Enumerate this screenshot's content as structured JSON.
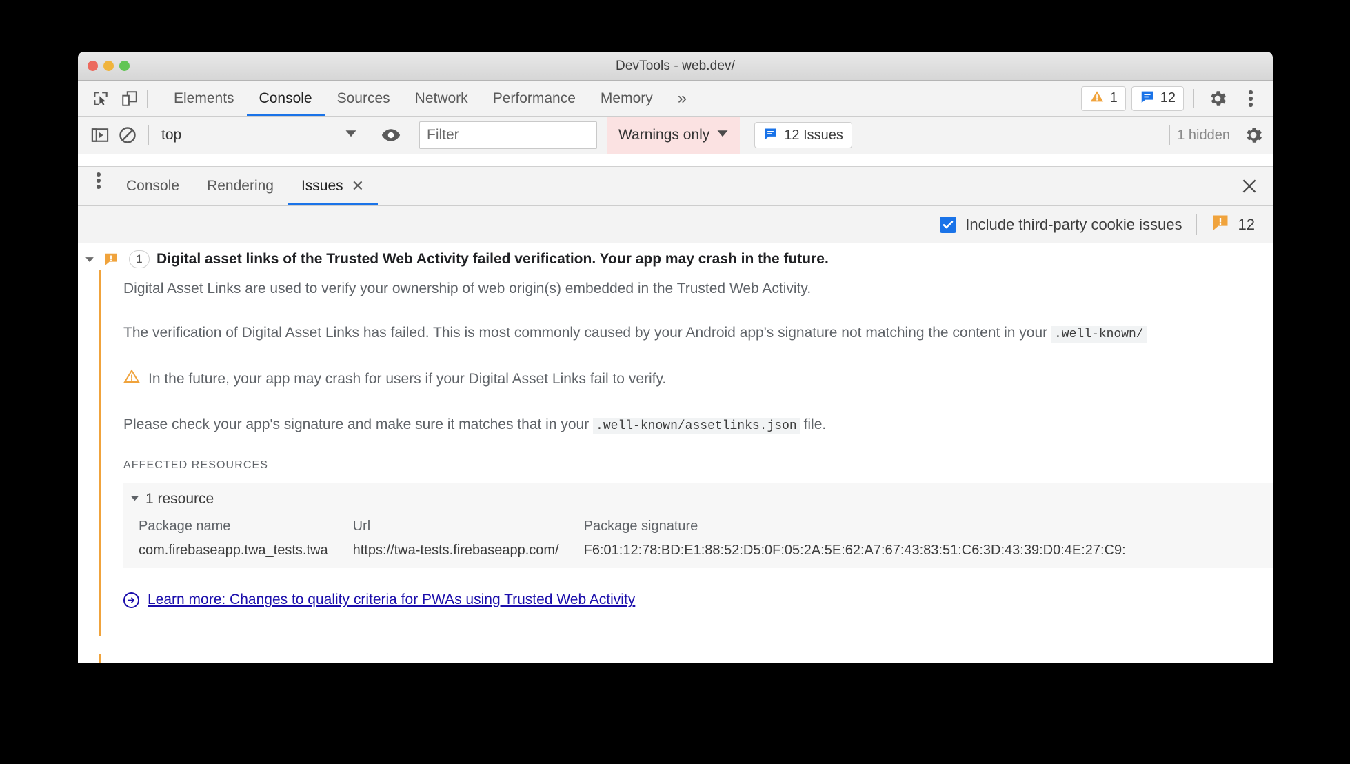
{
  "window": {
    "title": "DevTools - web.dev/",
    "traffic_lights": [
      "close",
      "minimize",
      "zoom"
    ]
  },
  "main_tabbar": {
    "left_icons": [
      {
        "name": "inspect-element-icon",
        "label": "Inspect element"
      },
      {
        "name": "device-toolbar-icon",
        "label": "Toggle device toolbar"
      }
    ],
    "tabs": [
      {
        "label": "Elements",
        "active": false
      },
      {
        "label": "Console",
        "active": true
      },
      {
        "label": "Sources",
        "active": false
      },
      {
        "label": "Network",
        "active": false
      },
      {
        "label": "Performance",
        "active": false
      },
      {
        "label": "Memory",
        "active": false
      }
    ],
    "more_tabs_label": "»",
    "warning_badge": {
      "icon": "warning-triangle-icon",
      "count": "1"
    },
    "issues_badge": {
      "icon": "issue-message-icon",
      "count": "12"
    },
    "settings_label": "Settings",
    "menu_label": "Customize and control DevTools"
  },
  "console_toolbar": {
    "sidebar_toggle": "console-sidebar-icon",
    "clear_console": "clear-console-icon",
    "context": {
      "value": "top",
      "caret": "▼"
    },
    "eye_icon": "live-expression-icon",
    "filter": {
      "value": "",
      "placeholder": "Filter"
    },
    "level": {
      "value": "Warnings only",
      "caret": "▼"
    },
    "issues_button": {
      "label": "12 Issues",
      "icon": "issue-message-icon"
    },
    "hidden_text": "1 hidden",
    "settings_icon": "gear-icon"
  },
  "drawer": {
    "menu_icon": "more-options-icon",
    "tabs": [
      {
        "label": "Console",
        "active": false,
        "closable": false
      },
      {
        "label": "Rendering",
        "active": false,
        "closable": false
      },
      {
        "label": "Issues",
        "active": true,
        "closable": true,
        "close_glyph": "✕"
      }
    ],
    "close_drawer_glyph": "✕"
  },
  "issues_toolbar": {
    "checkbox": {
      "label": "Include third-party cookie issues",
      "checked": true,
      "check_glyph": "✓"
    },
    "count_icon": "issue-bubble-icon",
    "count": "12"
  },
  "issue": {
    "disclosure_glyph": "▼",
    "kind_icon": "issue-bubble-icon",
    "count_pill": "1",
    "title": "Digital asset links of the Trusted Web Activity failed verification. Your app may crash in the future.",
    "paragraphs": [
      {
        "parts": [
          {
            "type": "text",
            "value": "Digital Asset Links are used to verify your ownership of web origin(s) embedded in the Trusted Web Activity."
          }
        ]
      },
      {
        "parts": [
          {
            "type": "text",
            "value": "The verification of Digital Asset Links has failed. This is most commonly caused by your Android app's signature not matching the content in your "
          },
          {
            "type": "code",
            "value": ".well-known/assetlinks.json"
          },
          {
            "type": "text",
            "value": " file."
          }
        ]
      }
    ],
    "p1": "Digital Asset Links are used to verify your ownership of web origin(s) embedded in the Trusted Web Activity.",
    "p2_before": "The verification of Digital Asset Links has failed. This is most commonly caused by your Android app's signature not matching the content in your ",
    "p2_code": ".well-known/",
    "warning_icon": "warning-triangle-icon",
    "p3": "In the future, your app may crash for users if your Digital Asset Links fail to verify.",
    "p4_before": "Please check your app's signature and make sure it matches that in your ",
    "p4_code": ".well-known/assetlinks.json",
    "p4_after": " file.",
    "affected_label": "Affected resources",
    "resource_toggle": {
      "glyph": "▾",
      "label": "1 resource"
    },
    "table": {
      "headers": [
        "Package name",
        "Url",
        "Package signature"
      ],
      "rows": [
        [
          "com.firebaseapp.twa_tests.twa",
          "https://twa-tests.firebaseapp.com/",
          "F6:01:12:78:BD:E1:88:52:D5:0F:05:2A:5E:62:A7:67:43:83:51:C6:3D:43:39:D0:4E:27:C9:"
        ]
      ]
    },
    "learn_more": {
      "icon": "external-link-circle-icon",
      "label": "Learn more: Changes to quality criteria for PWAs using Trusted Web Activity"
    }
  },
  "colors": {
    "accent_blue": "#1a73e8",
    "issue_orange": "#f0a33c",
    "link_blue": "#1a0dab",
    "filter_active_bg": "#fbe2e2"
  }
}
